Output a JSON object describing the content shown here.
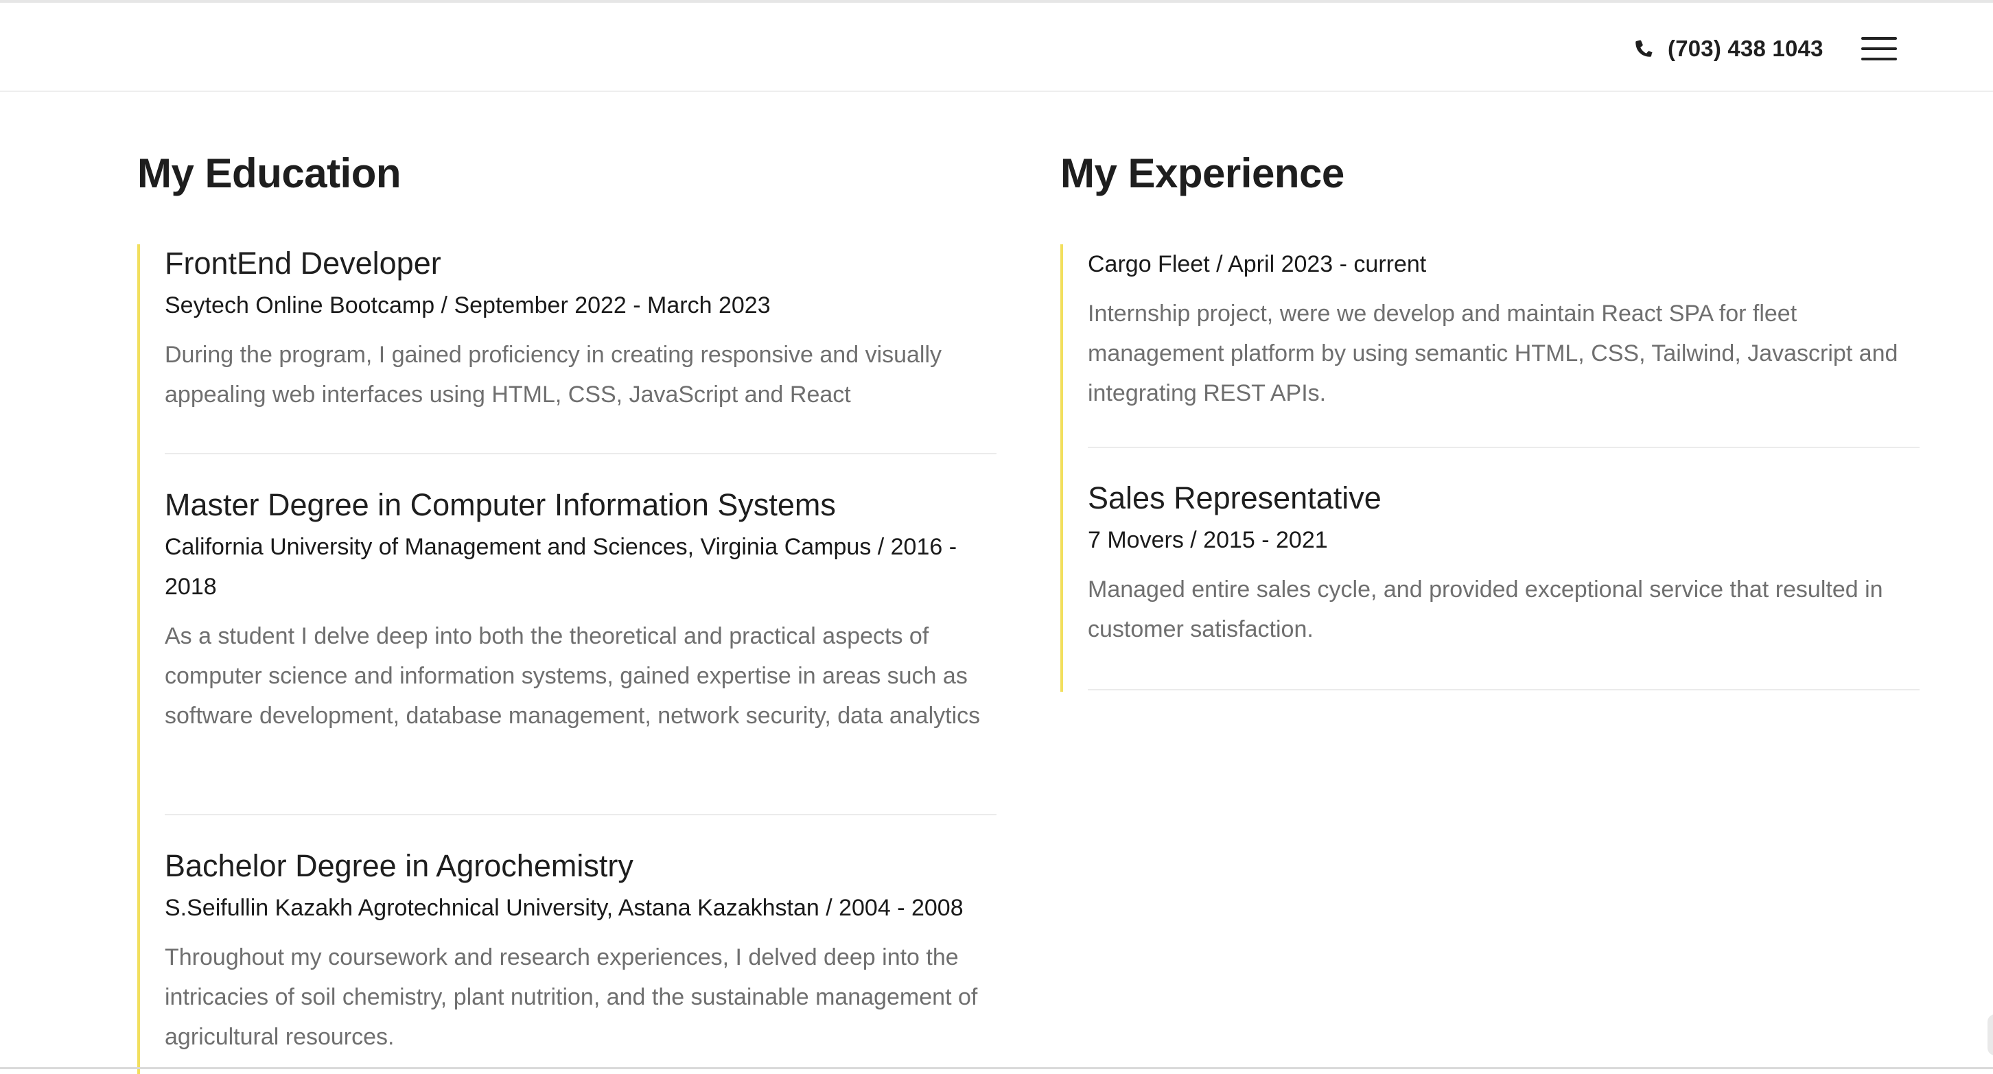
{
  "header": {
    "phone_icon": "phone-icon",
    "phone_number": "(703) 438 1043",
    "menu_icon": "hamburger-menu-icon"
  },
  "education": {
    "title": "My Education",
    "items": [
      {
        "title": "FrontEnd Developer",
        "meta": "Seytech Online Bootcamp / September 2022 - March 2023",
        "description": "During the program, I gained proficiency in creating responsive and visually appealing web interfaces using HTML, CSS, JavaScript and React"
      },
      {
        "title": "Master Degree in Computer Information Systems",
        "meta": "California University of Management and Sciences, Virginia Campus / 2016 - 2018",
        "description": "As a student I delve deep into both the theoretical and practical aspects of computer science and information systems, gained expertise in areas such as software development, database management, network security, data analytics"
      },
      {
        "title": "Bachelor Degree in Agrochemistry",
        "meta": "S.Seifullin Kazakh Agrotechnical University, Astana Kazakhstan / 2004 - 2008",
        "description": "Throughout my coursework and research experiences, I delved deep into the intricacies of soil chemistry, plant nutrition, and the sustainable management of agricultural resources."
      }
    ]
  },
  "experience": {
    "title": "My Experience",
    "items": [
      {
        "title": "",
        "meta": "Cargo Fleet / April 2023 - current",
        "description": "Internship project, were we develop and maintain React SPA for fleet management platform by using semantic HTML, CSS, Tailwind, Javascript and integrating REST APIs."
      },
      {
        "title": "Sales Representative",
        "meta": "7 Movers / 2015 - 2021",
        "description": "Managed entire sales cycle, and provided exceptional service that resulted in customer satisfaction."
      }
    ]
  },
  "colors": {
    "accent": "#f2df5e",
    "heading": "#1e1e1e",
    "body_muted": "#6f6f6f",
    "divider": "#ebebeb"
  }
}
